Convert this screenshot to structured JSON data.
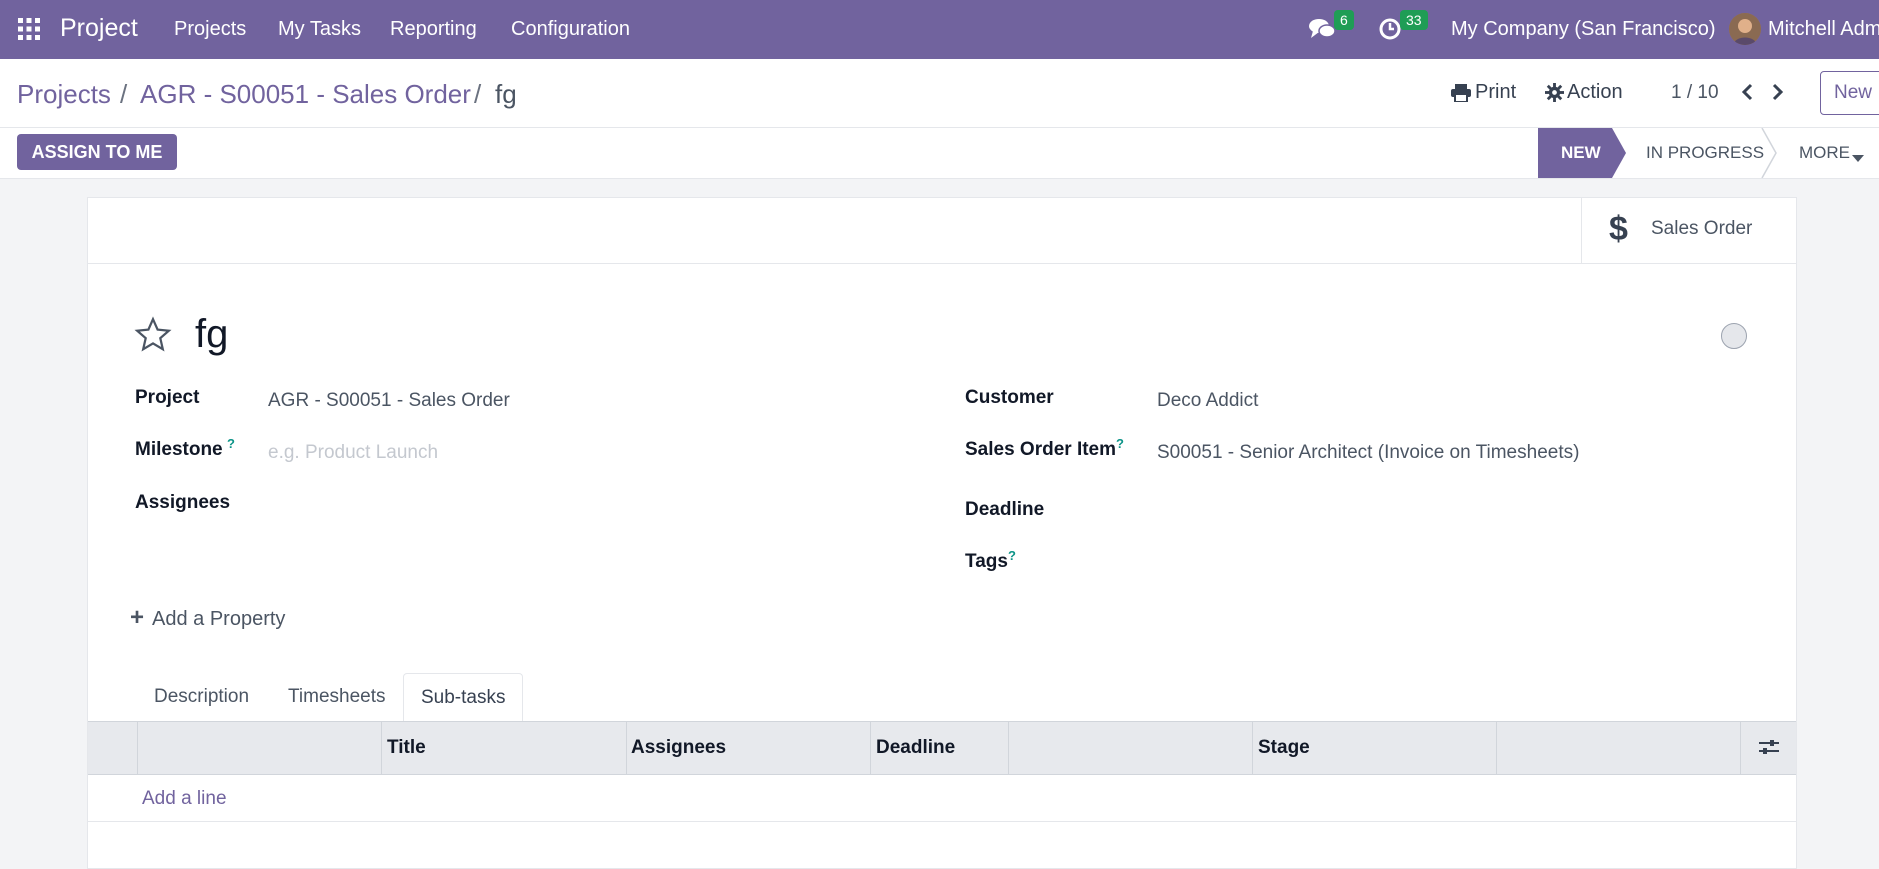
{
  "topbar": {
    "app_name": "Project",
    "menu": [
      "Projects",
      "My Tasks",
      "Reporting",
      "Configuration"
    ],
    "messages_count": "6",
    "activities_count": "33",
    "company": "My Company (San Francisco)",
    "user": "Mitchell Adm",
    "colors": {
      "brand": "#71639e",
      "badge": "#1f9d55"
    }
  },
  "breadcrumb": {
    "items": [
      "Projects",
      "AGR - S00051 - Sales Order",
      "fg"
    ],
    "separator": "/"
  },
  "control": {
    "print_label": "Print",
    "action_label": "Action",
    "pager": "1 / 10",
    "new_label": "New"
  },
  "statusbar": {
    "assign_label": "ASSIGN TO ME",
    "stages": [
      "NEW",
      "IN PROGRESS"
    ],
    "more_label": "MORE",
    "active_stage": "NEW"
  },
  "smart_buttons": {
    "sales_order_label": "Sales Order"
  },
  "task": {
    "title": "fg",
    "fields": {
      "project_label": "Project",
      "project_value": "AGR - S00051 - Sales Order",
      "milestone_label": "Milestone",
      "milestone_placeholder": "e.g. Product Launch",
      "assignees_label": "Assignees",
      "customer_label": "Customer",
      "customer_value": "Deco Addict",
      "so_item_label": "Sales Order Item",
      "so_item_value": "S00051 - Senior Architect (Invoice on Timesheets)",
      "deadline_label": "Deadline",
      "tags_label": "Tags"
    },
    "add_property": "Add a Property",
    "help_mark": "?"
  },
  "tabs": [
    "Description",
    "Timesheets",
    "Sub-tasks"
  ],
  "active_tab": "Sub-tasks",
  "subtasks_table": {
    "columns": [
      "Title",
      "Assignees",
      "Deadline",
      "Stage"
    ],
    "add_line": "Add a line"
  }
}
